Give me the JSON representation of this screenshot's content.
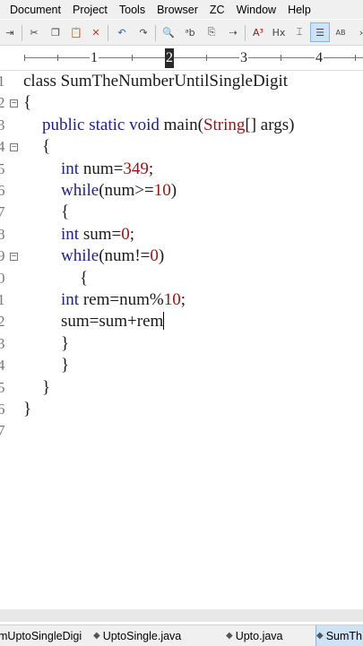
{
  "menu": [
    "Document",
    "Project",
    "Tools",
    "Browser",
    "ZC",
    "Window",
    "Help"
  ],
  "ruler": {
    "marks": [
      "1",
      "2",
      "3",
      "4"
    ]
  },
  "code": {
    "lines": [
      [
        {
          "t": "class SumTheNumberUntilSingleDigit",
          "c": ""
        }
      ],
      [
        {
          "t": "{",
          "c": ""
        }
      ],
      [
        {
          "t": "public static void ",
          "c": "kw"
        },
        {
          "t": "main(",
          "c": ""
        },
        {
          "t": "String",
          "c": "cls"
        },
        {
          "t": "[] args)",
          "c": ""
        }
      ],
      [
        {
          "t": "{",
          "c": ""
        }
      ],
      [
        {
          "t": "int ",
          "c": "kw"
        },
        {
          "t": "num=",
          "c": ""
        },
        {
          "t": "349",
          "c": "num"
        },
        {
          "t": ";",
          "c": ""
        }
      ],
      [
        {
          "t": "while",
          "c": "kw"
        },
        {
          "t": "(num>=",
          "c": ""
        },
        {
          "t": "10",
          "c": "num"
        },
        {
          "t": ")",
          "c": ""
        }
      ],
      [
        {
          "t": "{",
          "c": ""
        }
      ],
      [
        {
          "t": "int ",
          "c": "kw"
        },
        {
          "t": "sum=",
          "c": ""
        },
        {
          "t": "0",
          "c": "num"
        },
        {
          "t": ";",
          "c": ""
        }
      ],
      [
        {
          "t": "while",
          "c": "kw"
        },
        {
          "t": "(num!=",
          "c": ""
        },
        {
          "t": "0",
          "c": "num"
        },
        {
          "t": ")",
          "c": ""
        }
      ],
      [
        {
          "t": "{",
          "c": ""
        }
      ],
      [
        {
          "t": "int ",
          "c": "kw"
        },
        {
          "t": "rem=num%",
          "c": ""
        },
        {
          "t": "10",
          "c": "num"
        },
        {
          "t": ";",
          "c": ""
        }
      ],
      [
        {
          "t": "sum=sum+rem",
          "c": ""
        }
      ],
      [
        {
          "t": "}",
          "c": ""
        }
      ],
      [
        {
          "t": "}",
          "c": ""
        }
      ],
      [
        {
          "t": "}",
          "c": ""
        }
      ],
      [
        {
          "t": "}",
          "c": ""
        }
      ],
      []
    ],
    "line_numbers": [
      "1",
      "2",
      "3",
      "4",
      "5",
      "6",
      "7",
      "8",
      "9",
      "0",
      "1",
      "2",
      "3",
      "4",
      "5",
      "6",
      "7"
    ]
  },
  "tabs": [
    {
      "label": "mUptoSingleDigi",
      "active": false
    },
    {
      "label": "UptoSingle.java",
      "active": false
    },
    {
      "label": "Upto.java",
      "active": false
    },
    {
      "label": "SumTh",
      "active": true
    }
  ]
}
